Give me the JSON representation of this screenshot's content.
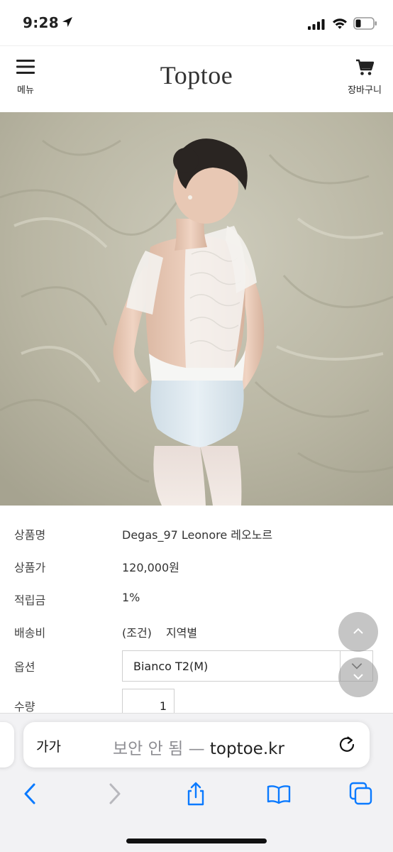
{
  "status_bar": {
    "time": "9:28",
    "icons": [
      "location-arrow-icon",
      "cellular-signal-icon",
      "wifi-icon",
      "battery-low-icon"
    ]
  },
  "header": {
    "menu_label": "메뉴",
    "brand": "Toptoe",
    "cart_label": "장바구니",
    "icons": [
      "hamburger-menu-icon",
      "shopping-cart-icon"
    ]
  },
  "product": {
    "rows": [
      {
        "label": "상품명",
        "value": "Degas_97 Leonore 레오노르"
      },
      {
        "label": "상품가",
        "value": "120,000원"
      },
      {
        "label": "적립금",
        "value": "1%"
      },
      {
        "label": "배송비",
        "value": "(조건)",
        "value2": "지역별"
      }
    ],
    "option_label": "옵션",
    "option_selected": "Bianco T2(M)",
    "qty_label": "수량",
    "qty_value": "1"
  },
  "browser": {
    "text_size_button": "가가",
    "insecure_label": "보안 안 됨 —",
    "domain": "toptoe.kr",
    "icons": [
      "reload-icon",
      "back-icon",
      "forward-icon",
      "share-icon",
      "bookmarks-icon",
      "tabs-icon"
    ]
  },
  "colors": {
    "accent_blue": "#0a7aff",
    "disabled_gray": "#b8b8bd",
    "insecure_gray": "#8e8e93",
    "scroll_button": "#969696"
  }
}
